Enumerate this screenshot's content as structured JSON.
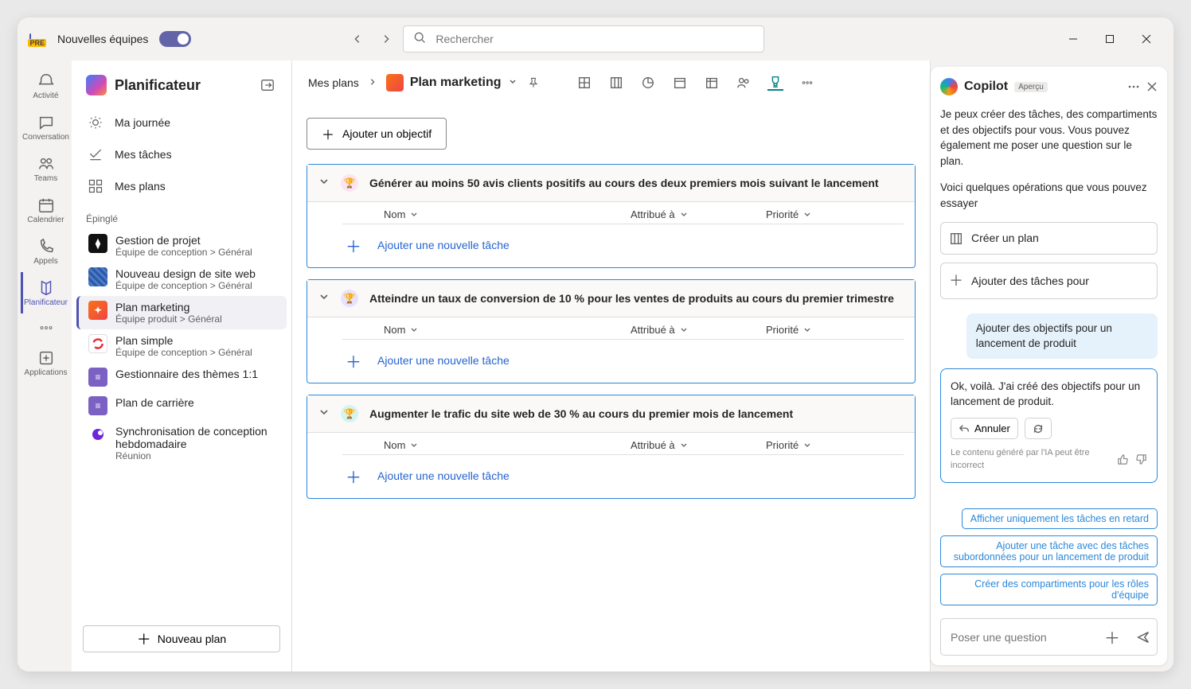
{
  "titlebar": {
    "app_label": "Nouvelles équipes",
    "search_placeholder": "Rechercher"
  },
  "apprail": {
    "items": [
      {
        "label": "Activité"
      },
      {
        "label": "Conversation"
      },
      {
        "label": "Teams"
      },
      {
        "label": "Calendrier"
      },
      {
        "label": "Appels"
      },
      {
        "label": "Planificateur"
      }
    ],
    "more": "",
    "apps": "Applications"
  },
  "sidebar": {
    "title": "Planificateur",
    "nav": [
      {
        "label": "Ma journée"
      },
      {
        "label": "Mes tâches"
      },
      {
        "label": "Mes plans"
      }
    ],
    "pinned_label": "Épinglé",
    "pinned": [
      {
        "title": "Gestion de projet",
        "sub": "Équipe de conception > Général",
        "color": "#111"
      },
      {
        "title": "Nouveau design de site web",
        "sub": "Équipe de conception > Général",
        "color": "#2b5aa6"
      },
      {
        "title": "Plan marketing",
        "sub": "Équipe produit > Général",
        "color": "linear-gradient(135deg,#f97316,#ef4444)",
        "selected": true
      },
      {
        "title": "Plan simple",
        "sub": "Équipe de conception > Général",
        "color": "#fff"
      },
      {
        "title": "Gestionnaire des thèmes 1:1",
        "sub": "",
        "color": "#7b61c4"
      },
      {
        "title": "Plan de carrière",
        "sub": "",
        "color": "#7b61c4"
      },
      {
        "title": "Synchronisation de conception hebdomadaire",
        "sub": "Réunion",
        "color": "#6d28d9"
      }
    ],
    "new_plan": "Nouveau plan"
  },
  "main": {
    "crumb_root": "Mes plans",
    "plan_name": "Plan marketing",
    "add_objective": "Ajouter un objectif",
    "columns": {
      "name": "Nom",
      "assigned": "Attribué à",
      "priority": "Priorité"
    },
    "add_task": "Ajouter une nouvelle tâche",
    "goals": [
      {
        "color": "t-pink",
        "title": "Générer au moins 50 avis clients positifs au cours des deux premiers mois suivant le lancement"
      },
      {
        "color": "t-violet",
        "title": "Atteindre un taux de conversion de 10 % pour les ventes de produits au cours du premier trimestre"
      },
      {
        "color": "t-teal",
        "title": "Augmenter le trafic du site web de 30 % au cours du premier mois de lancement"
      }
    ]
  },
  "copilot": {
    "title": "Copilot",
    "badge": "Aperçu",
    "intro": "Je peux créer des tâches, des compartiments et des objectifs pour vous. Vous pouvez également me poser une question sur le plan.",
    "intro2": "Voici quelques opérations que vous pouvez essayer",
    "sugg": [
      "Créer un plan",
      "Ajouter des tâches pour"
    ],
    "user_msg": "Ajouter des objectifs pour un lancement de produit",
    "ai_msg": "Ok, voilà. J'ai créé des objectifs pour un lancement de produit.",
    "cancel": "Annuler",
    "ai_disclaimer": "Le contenu généré par l'IA peut être incorrect",
    "chips": [
      "Afficher uniquement les tâches en retard",
      "Ajouter une tâche avec des tâches subordonnées pour un lancement de produit",
      "Créer des compartiments pour les rôles d'équipe"
    ],
    "input_placeholder": "Poser une question"
  }
}
